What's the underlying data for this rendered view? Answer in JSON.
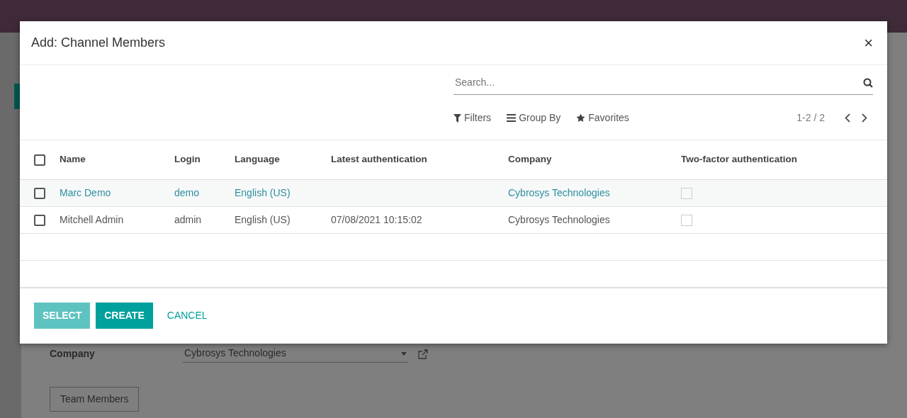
{
  "background_form": {
    "fields": [
      {
        "label": "Company",
        "value": "Cybrosys Technologies"
      }
    ],
    "tab": "Team Members"
  },
  "dialog": {
    "title": "Add: Channel Members",
    "close": "×",
    "search": {
      "placeholder": "Search..."
    },
    "filters": [
      {
        "label": "Filters",
        "kind": "filter"
      },
      {
        "label": "Group By",
        "kind": "group"
      },
      {
        "label": "Favorites",
        "kind": "favorite"
      }
    ],
    "pager": "1-2 / 2",
    "table": {
      "select_all": {
        "checked": false
      },
      "columns": [
        "Name",
        "Login",
        "Language",
        "Latest authentication",
        "Company",
        "Two-factor authentication"
      ],
      "rows": [
        {
          "selected": false,
          "highlighted": true,
          "name": "Marc Demo",
          "login": "demo",
          "language": "English (US)",
          "latest_authentication": "",
          "company": "Cybrosys Technologies",
          "two_factor": false
        },
        {
          "selected": false,
          "highlighted": false,
          "name": "Mitchell Admin",
          "login": "admin",
          "language": "English (US)",
          "latest_authentication": "07/08/2021 10:15:02",
          "company": "Cybrosys Technologies",
          "two_factor": false
        }
      ]
    },
    "buttons": [
      {
        "label": "SELECT",
        "kind": "light"
      },
      {
        "label": "CREATE",
        "kind": "primary"
      },
      {
        "label": "CANCEL",
        "kind": "link"
      }
    ]
  }
}
